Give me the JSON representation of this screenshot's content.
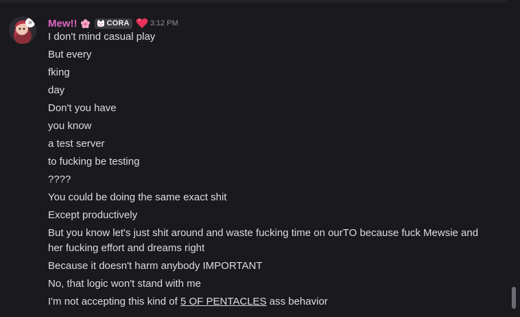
{
  "message": {
    "username": "Mew!!",
    "tag_label": "CORA",
    "timestamp": "3:12 PM",
    "icons": {
      "avatar": "anime-avatar-icon",
      "flower": "cherry-blossom-icon",
      "tag": "cat-face-icon",
      "heart": "heart-emoji-icon"
    },
    "colors": {
      "username": "#e266c4",
      "text": "#dbdee1",
      "background": "#1a1a1e",
      "timestamp": "#8e9099"
    },
    "lines": [
      "I don't mind casual play",
      "But every",
      "fking",
      "day",
      "Don't you have",
      "you know",
      "a test server",
      "to fucking be testing",
      "????",
      "You could be doing the same exact shit",
      "Except productively",
      "But you know let's just shit around and waste fucking time on ourTO because fuck Mewsie and her fucking effort and dreams right",
      "Because it doesn't harm anybody IMPORTANT",
      "No, that logic won't stand with me"
    ],
    "last_line": {
      "prefix": "I'm not accepting this kind of ",
      "link": "5 OF PENTACLES",
      "suffix": " ass behavior"
    }
  }
}
